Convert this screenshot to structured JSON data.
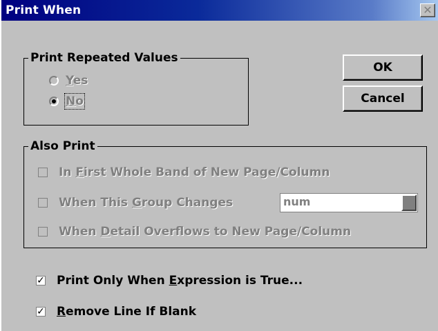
{
  "window": {
    "title": "Print When",
    "close_symbol": "✕"
  },
  "repeated": {
    "legend": "Print Repeated Values",
    "yes_pre": "",
    "yes_acc": "Y",
    "yes_post": "es",
    "no_pre": "",
    "no_acc": "N",
    "no_post": "o",
    "selected": "No"
  },
  "buttons": {
    "ok": "OK",
    "cancel": "Cancel"
  },
  "also": {
    "legend": "Also Print",
    "first_pre": "In ",
    "first_acc": "F",
    "first_post": "irst Whole Band of New Page/Column",
    "group_pre": "When This ",
    "group_acc": "G",
    "group_post": "roup Changes",
    "group_value": "num",
    "detail_pre": "When ",
    "detail_acc": "D",
    "detail_post": "etail Overflows to New Page/Column"
  },
  "options": {
    "expr_pre": "Print Only When ",
    "expr_acc": "E",
    "expr_post": "xpression is True...",
    "expr_checked": true,
    "remove_pre": "",
    "remove_acc": "R",
    "remove_post": "emove Line If Blank",
    "remove_checked": true,
    "check_mark": "✓"
  }
}
